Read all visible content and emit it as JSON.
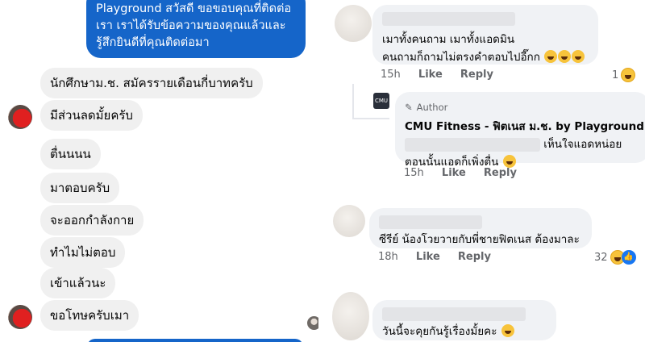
{
  "chat": {
    "outgoing_top": [
      "Playground สวัสดี ขอขอบคุณที่ติดต่อ",
      "เรา เราได้รับข้อความของคุณแล้วและ",
      "รู้สึกยินดีที่คุณติดต่อมา"
    ],
    "messages": [
      "นักศึกษาม.ช. สมัครรายเดือนกี่บาทครับ",
      "มีส่วนลดมั้ยครับ",
      "ตื่นนนน",
      "มาตอบครับ",
      "จะออกกำลังกาย",
      "ทำไมไม่ตอบ",
      "เข้าแล้วนะ",
      "ขอโทษครับเมา"
    ]
  },
  "comments": [
    {
      "lines": [
        "เมาทั้งคนถาม เมาทั้งแอดมิน",
        "คนถามก็ถามไม่ตรงคำตอบไปอี๊กก"
      ],
      "time": "15h",
      "like": "Like",
      "reply": "Reply",
      "reactions": "1"
    },
    {
      "badge": "Author",
      "author": "CMU Fitness - ฟิตเนส ม.ช. by Playground",
      "lines": [
        "เห็นใจแอดหน่อย",
        "ตอนนั้นแอดก็เพิ่งตื่น"
      ],
      "time": "15h",
      "like": "Like",
      "reply": "Reply"
    },
    {
      "lines": [
        "ซีรีย์ น้องโวยวายกับพี่ชายฟิตเนส ต้องมาละ"
      ],
      "time": "18h",
      "like": "Like",
      "reply": "Reply",
      "reactions": "32"
    },
    {
      "lines": [
        "วันนี้จะคุยกันรู้เรื่องมั้ยคะ"
      ]
    }
  ],
  "colors": {
    "messenger_blue": "#1565c9",
    "bubble_gray": "#f0f0f0",
    "comment_gray": "#f0f2f5",
    "meta_gray": "#65676b"
  }
}
